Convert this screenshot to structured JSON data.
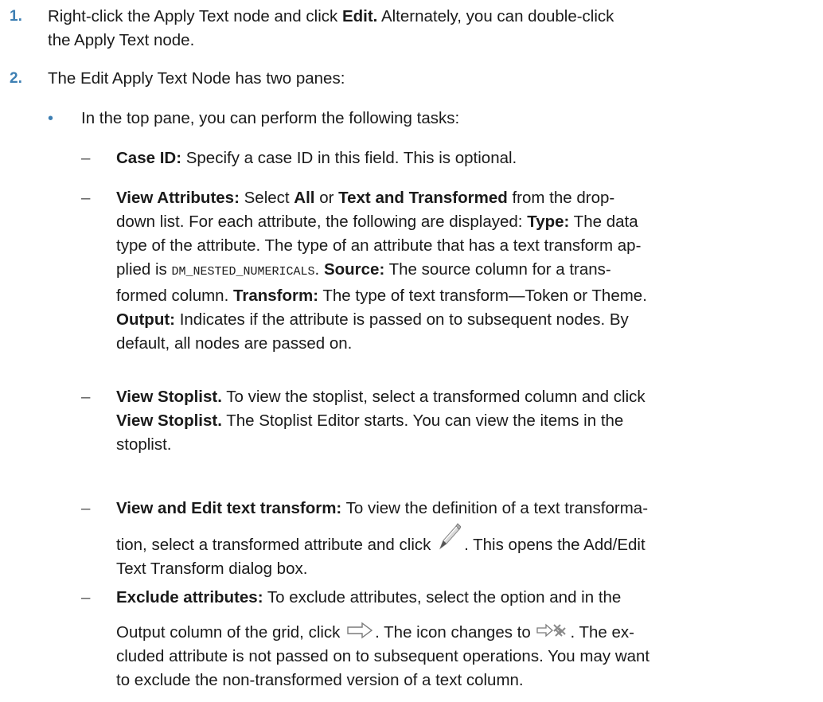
{
  "step1": {
    "num": "1.",
    "pre": "Right-click the Apply Text node and click ",
    "bold": "Edit.",
    "post1": " Alternately, you can double-click",
    "post2": "the Apply Text node."
  },
  "step2": {
    "num": "2.",
    "text": "The Edit Apply Text Node has two panes:"
  },
  "bullet": {
    "mark": "•",
    "text": "In the top pane, you can perform the following tasks:"
  },
  "dash": "–",
  "case_id": {
    "label": "Case ID:",
    "text": " Specify a case ID in this field. This is optional."
  },
  "view_attributes": {
    "label": "View Attributes:",
    "t1": " Select ",
    "all": "All",
    "or": " or ",
    "text_transformed": "Text and Transformed",
    "t2": " from the drop-",
    "line2a": "down list. For each attribute, the following are displayed: ",
    "type_label": "Type:",
    "line2b": " The data",
    "line3": "type of the attribute. The type of an attribute that has a text transform ap-",
    "line4a": "plied is ",
    "mono": "DM_NESTED_NUMERICALS",
    "line4b": ". ",
    "source_label": "Source:",
    "line4c": " The source column for a trans-",
    "line5a": "formed column. ",
    "transform_label": "Transform:",
    "line5b": " The type of text transform—Token or Theme.",
    "output_label": "Output:",
    "line6b": " Indicates if the attribute is passed on to subsequent nodes. By",
    "line7": "default, all nodes are passed on."
  },
  "view_stoplist": {
    "label": "View Stoplist.",
    "line1": " To view the stoplist, select a transformed column and click",
    "label2": "View Stoplist.",
    "line2": " The Stoplist Editor starts. You can view the items in the",
    "line3": "stoplist."
  },
  "view_edit": {
    "label": "View and Edit text transform:",
    "line1": " To view the definition of a text transforma-",
    "line2a": "tion, select a transformed attribute and click ",
    "line2b": ". This opens the Add/Edit",
    "line3": "Text Transform dialog box."
  },
  "exclude": {
    "label": "Exclude attributes:",
    "line1": " To exclude attributes, select the option and in the",
    "line2a": "Output column of the grid, click ",
    "line2b": ". The icon changes to ",
    "line2c": ". The ex-",
    "line3": "cluded attribute is not passed on to subsequent operations. You may want",
    "line4": "to exclude the non-transformed version of a text column."
  },
  "icons": {
    "pencil": "pencil-icon",
    "arrow": "arrow-right-icon",
    "excluded": "excluded-arrow-icon"
  },
  "colors": {
    "accent": "#3d7fb3"
  }
}
